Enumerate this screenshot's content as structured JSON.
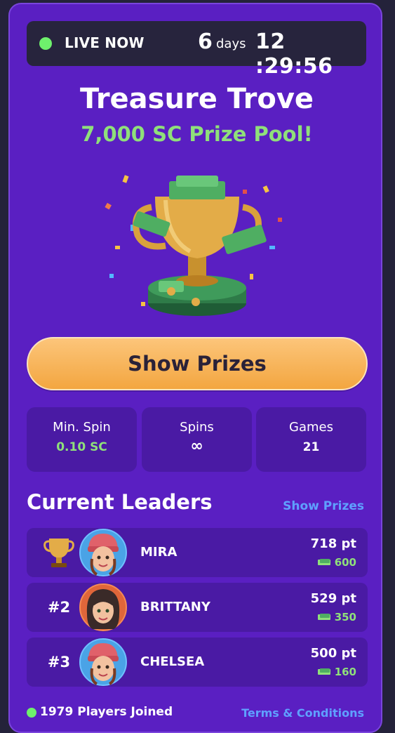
{
  "header": {
    "live_label": "LIVE NOW",
    "days_value": "6",
    "days_label": "days",
    "time": "12 :29:56"
  },
  "tournament": {
    "title": "Treasure Trove",
    "subtitle": "7,000 SC Prize Pool!",
    "image_icon": "trophy-with-money-icon"
  },
  "cta": {
    "show_prizes_label": "Show Prizes"
  },
  "stats": [
    {
      "label": "Min. Spin",
      "value": "0.10 SC",
      "color": "#8fe07a"
    },
    {
      "label": "Spins",
      "value": "∞",
      "color": "#ffffff"
    },
    {
      "label": "Games",
      "value": "21",
      "color": "#ffffff"
    }
  ],
  "leaders": {
    "title": "Current Leaders",
    "link_label": "Show Prizes",
    "rows": [
      {
        "rank": "",
        "rank_icon": "trophy-icon",
        "name": "MIRA",
        "points": "718 pt",
        "reward": "600",
        "avatar": "avatar-beanie"
      },
      {
        "rank": "#2",
        "name": "BRITTANY",
        "points": "529 pt",
        "reward": "350",
        "avatar": "avatar-dark-hair"
      },
      {
        "rank": "#3",
        "name": "CHELSEA",
        "points": "500 pt",
        "reward": "160",
        "avatar": "avatar-beanie"
      }
    ]
  },
  "footer": {
    "players_joined": "1979 Players Joined",
    "terms_label": "Terms & Conditions"
  },
  "colors": {
    "background": "#24223a",
    "card": "#5a1fc2",
    "accent_green": "#8fe07a",
    "link_blue": "#5fa0ff",
    "button_orange": "#f3a640"
  }
}
